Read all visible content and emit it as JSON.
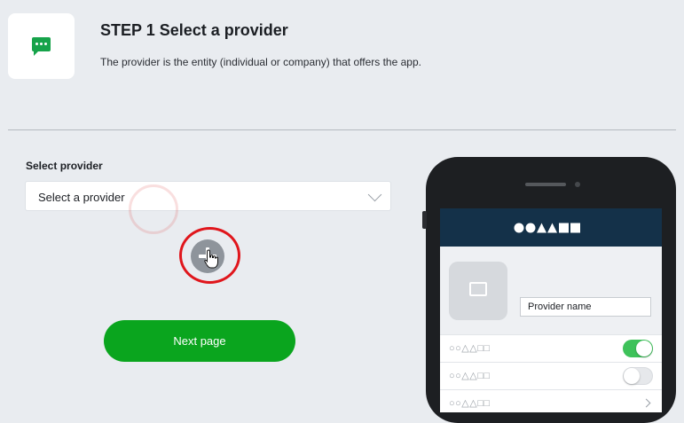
{
  "step": {
    "title": "STEP 1 Select a provider",
    "description": "The provider is the entity (individual or company) that offers the app.",
    "icon": "chat-bubble-icon",
    "accent": "#16a34a"
  },
  "form": {
    "label": "Select provider",
    "select_value": "Select a provider",
    "add_button_icon": "plus-icon",
    "next_label": "Next page",
    "next_color": "#0aa51e"
  },
  "preview": {
    "logo": "●●▲▲■■",
    "header_color": "#143149",
    "provider_name": "Provider name",
    "rows": [
      {
        "label": "○○△△□□",
        "control": "toggle",
        "on": true
      },
      {
        "label": "○○△△□□",
        "control": "toggle",
        "on": false
      },
      {
        "label": "○○△△□□",
        "control": "chevron"
      }
    ]
  }
}
